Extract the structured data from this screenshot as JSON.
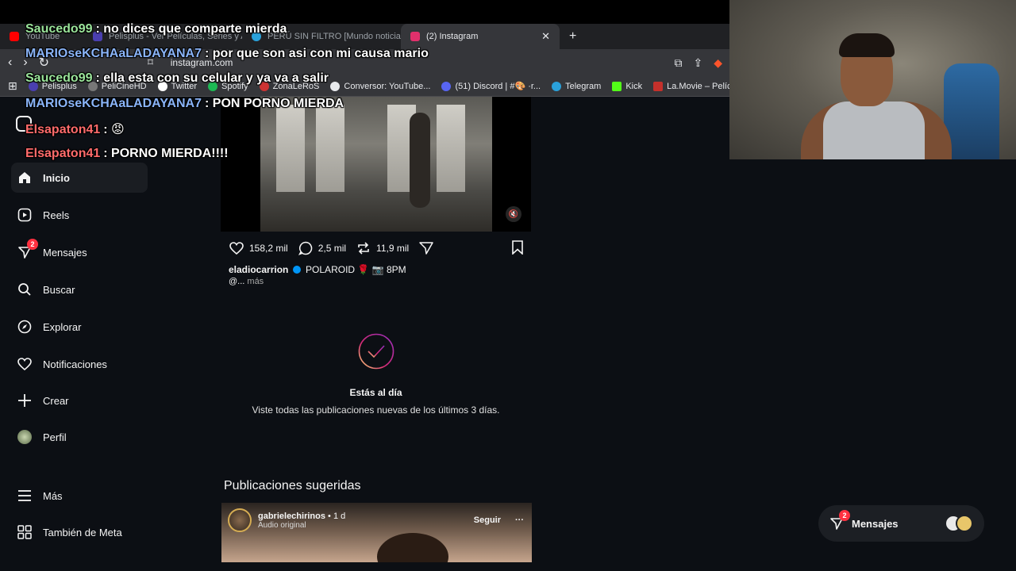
{
  "browser": {
    "tabs": [
      {
        "label": "YouTube",
        "active": false,
        "color": "#ff0000"
      },
      {
        "label": "Pelisplus - Ver Películas, Series y Anim",
        "active": false,
        "color": "#4a3fb0"
      },
      {
        "label": "PERÚ SIN FILTRO [Mundo noticias]",
        "active": false,
        "color": "#2aa1da"
      },
      {
        "label": "(2) Instagram",
        "active": true,
        "color": "#e1306c"
      }
    ],
    "url": "instagram.com",
    "bookmarks": [
      {
        "label": "Pelisplus",
        "color": "#4a3fb0"
      },
      {
        "label": "PeliCineHD",
        "color": "#777777"
      },
      {
        "label": "Twitter",
        "color": "#ffffff"
      },
      {
        "label": "Spotify",
        "color": "#1db954"
      },
      {
        "label": "ZonaLeRoS",
        "color": "#cc3333"
      },
      {
        "label": "Conversor: YouTube...",
        "color": "#e8eaed"
      },
      {
        "label": "(51) Discord | #🎨 ·r...",
        "color": "#5865f2"
      },
      {
        "label": "Telegram",
        "color": "#2aa1da"
      },
      {
        "label": "Kick",
        "color": "#53fc18"
      },
      {
        "label": "La.Movie – Películas,...",
        "color": "#c4302b"
      }
    ]
  },
  "sidebar": {
    "items": [
      {
        "label": "Inicio",
        "icon": "home-icon",
        "active": true
      },
      {
        "label": "Reels",
        "icon": "reels-icon"
      },
      {
        "label": "Mensajes",
        "icon": "messages-icon",
        "badge": "2"
      },
      {
        "label": "Buscar",
        "icon": "search-icon"
      },
      {
        "label": "Explorar",
        "icon": "explore-icon"
      },
      {
        "label": "Notificaciones",
        "icon": "heart-icon"
      },
      {
        "label": "Crear",
        "icon": "plus-icon"
      },
      {
        "label": "Perfil",
        "icon": "avatar"
      },
      {
        "label": "Más",
        "icon": "menu-icon"
      },
      {
        "label": "También de Meta",
        "icon": "meta-grid-icon"
      }
    ]
  },
  "post": {
    "likes": "158,2 mil",
    "comments": "2,5 mil",
    "reposts": "11,9 mil",
    "username": "eladiocarrion",
    "caption": "POLAROID 🌹 📷 8PM",
    "caption_more_prefix": "@...",
    "caption_more": "más"
  },
  "caught_up": {
    "title": "Estás al día",
    "subtitle": "Viste todas las publicaciones nuevas de los últimos 3 días."
  },
  "suggested": {
    "heading": "Publicaciones sugeridas",
    "username": "gabrielechirinos",
    "time": "• 1 d",
    "audio": "Audio original",
    "follow": "Seguir",
    "more": "···"
  },
  "chat": [
    {
      "user": "Saucedo99",
      "text": "no dices que comparte mierda",
      "color": "#9be59b"
    },
    {
      "user": "MARIOseKCHAaLADAYANA7",
      "text": "por que son asi con mi causa mario",
      "color": "#8ab4f8"
    },
    {
      "user": "Saucedo99",
      "text": "ella esta con su celular y ya va a salir",
      "color": "#9be59b"
    },
    {
      "user": "MARIOseKCHAaLADAYANA7",
      "text": "PON PORNO MIERDA",
      "color": "#8ab4f8"
    },
    {
      "user": "Elsapaton41",
      "text": "",
      "emote": "😡",
      "color": "#ff6b6b"
    },
    {
      "user": "Elsapaton41",
      "text": "PORNO MIERDA!!!!",
      "color": "#ff6b6b"
    }
  ],
  "messages_pill": {
    "label": "Mensajes",
    "badge": "2"
  }
}
